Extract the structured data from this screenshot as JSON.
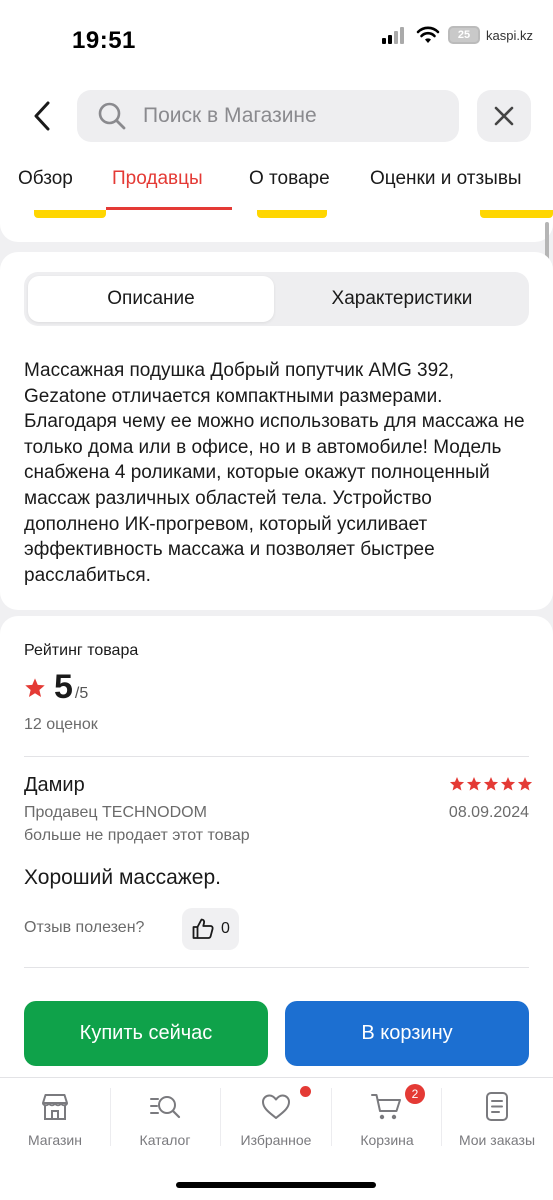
{
  "status_bar": {
    "time": "19:51",
    "battery": "25",
    "carrier": "kaspi.kz"
  },
  "search": {
    "placeholder": "Поиск в Магазине"
  },
  "tabs": [
    {
      "label": "Обзор"
    },
    {
      "label": "Продавцы",
      "active": true
    },
    {
      "label": "О товаре"
    },
    {
      "label": "Оценки и отзывы"
    }
  ],
  "description": {
    "segments": [
      "Описание",
      "Характеристики"
    ],
    "active_segment": "Описание",
    "text": "Массажная подушка Добрый попутчик AMG 392, Gezatone отличается компактными размерами. Благодаря чему ее можно использовать для массажа не только дома или в офисе, но и в автомобиле! Модель снабжена 4 роликами, которые окажут полноценный массаж различных областей тела. Устройство дополнено ИК-прогревом, который усиливает эффективность массажа и позволяет быстрее расслабиться."
  },
  "rating": {
    "title": "Рейтинг товара",
    "value": "5",
    "max": "/5",
    "count": "12 оценок"
  },
  "review": {
    "author": "Дамир",
    "stars": 5,
    "seller": "Продавец TECHNODOM",
    "date": "08.09.2024",
    "seller_note": "больше не продает этот товар",
    "text": "Хороший массажер.",
    "helpful_label": "Отзыв полезен?",
    "likes": "0"
  },
  "actions": {
    "buy": "Купить сейчас",
    "cart": "В корзину"
  },
  "bottom_nav": [
    {
      "label": "Магазин",
      "icon": "store-icon"
    },
    {
      "label": "Каталог",
      "icon": "catalog-search-icon"
    },
    {
      "label": "Избранное",
      "icon": "heart-icon",
      "dot": true
    },
    {
      "label": "Корзина",
      "icon": "cart-icon",
      "badge": "2"
    },
    {
      "label": "Мои заказы",
      "icon": "orders-icon"
    }
  ],
  "colors": {
    "accent": "#e43a35",
    "buy": "#0fa24a",
    "cart": "#1c6fd1",
    "price_chip": "#ffd600"
  }
}
